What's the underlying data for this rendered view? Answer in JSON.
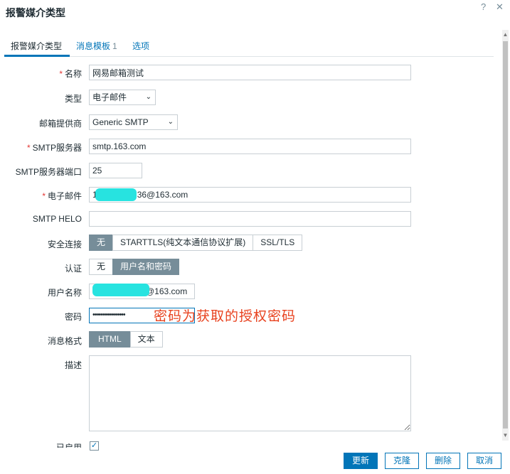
{
  "dialog": {
    "title": "报警媒介类型"
  },
  "tabs": [
    {
      "label": "报警媒介类型"
    },
    {
      "label": "消息模板",
      "count": "1"
    },
    {
      "label": "选项"
    }
  ],
  "form": {
    "name": {
      "label": "名称",
      "value": "网易邮箱测试"
    },
    "type": {
      "label": "类型",
      "value": "电子邮件"
    },
    "provider": {
      "label": "邮箱提供商",
      "value": "Generic SMTP"
    },
    "smtp_server": {
      "label": "SMTP服务器",
      "value": "smtp.163.com"
    },
    "smtp_port": {
      "label": "SMTP服务器端口",
      "value": "25"
    },
    "email": {
      "label": "电子邮件",
      "value_prefix": "1",
      "value_suffix": "36@163.com"
    },
    "smtp_helo": {
      "label": "SMTP HELO",
      "value": ""
    },
    "security": {
      "label": "安全连接",
      "options": [
        "无",
        "STARTTLS(纯文本通信协议扩展)",
        "SSL/TLS"
      ],
      "selected": 0
    },
    "auth": {
      "label": "认证",
      "options": [
        "无",
        "用户名和密码"
      ],
      "selected": 1
    },
    "username": {
      "label": "用户名称",
      "value_suffix": "@163.com"
    },
    "password": {
      "label": "密码",
      "value": "••••••••••••••••"
    },
    "message_format": {
      "label": "消息格式",
      "options": [
        "HTML",
        "文本"
      ],
      "selected": 0
    },
    "description": {
      "label": "描述",
      "value": ""
    },
    "enabled": {
      "label": "已启用",
      "checked": true
    }
  },
  "annotation": {
    "text": "密码为获取的授权密码"
  },
  "buttons": {
    "update": "更新",
    "clone": "克隆",
    "delete": "删除",
    "cancel": "取消"
  },
  "icons": {
    "help": "?",
    "close": "✕",
    "chevron": "⌄",
    "check": "✓"
  },
  "colors": {
    "accent": "#0275b8",
    "selected_segment": "#768d99",
    "required": "#e33734",
    "redaction": "#27e3e0",
    "annotation": "#e8421f"
  }
}
